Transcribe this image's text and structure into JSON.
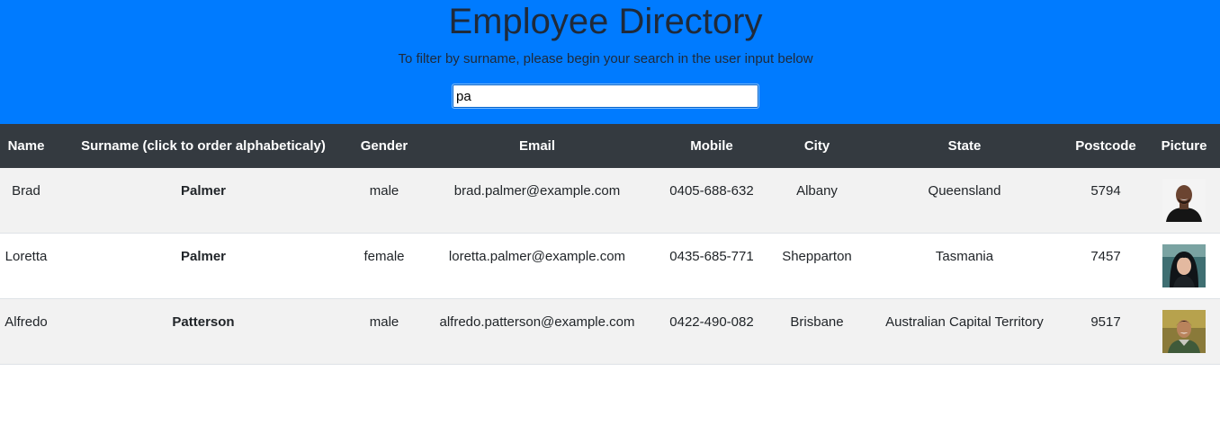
{
  "header": {
    "title": "Employee Directory",
    "subtitle": "To filter by surname, please begin your search in the user input below",
    "search_value": "pa"
  },
  "table": {
    "columns": [
      "Name",
      "Surname (click to order alphabeticaly)",
      "Gender",
      "Email",
      "Mobile",
      "City",
      "State",
      "Postcode",
      "Picture"
    ],
    "rows": [
      {
        "name": "Brad",
        "surname": "Palmer",
        "gender": "male",
        "email": "brad.palmer@example.com",
        "mobile": "0405-688-632",
        "city": "Albany",
        "state": "Queensland",
        "postcode": "5794",
        "picture": "portrait-man-smiling"
      },
      {
        "name": "Loretta",
        "surname": "Palmer",
        "gender": "female",
        "email": "loretta.palmer@example.com",
        "mobile": "0435-685-771",
        "city": "Shepparton",
        "state": "Tasmania",
        "postcode": "7457",
        "picture": "portrait-woman"
      },
      {
        "name": "Alfredo",
        "surname": "Patterson",
        "gender": "male",
        "email": "alfredo.patterson@example.com",
        "mobile": "0422-490-082",
        "city": "Brisbane",
        "state": "Australian Capital Territory",
        "postcode": "9517",
        "picture": "portrait-man-outdoors"
      }
    ]
  },
  "colors": {
    "header_bg": "#007bff",
    "table_head_bg": "#343a40",
    "row_stripe": "#f2f2f2"
  }
}
